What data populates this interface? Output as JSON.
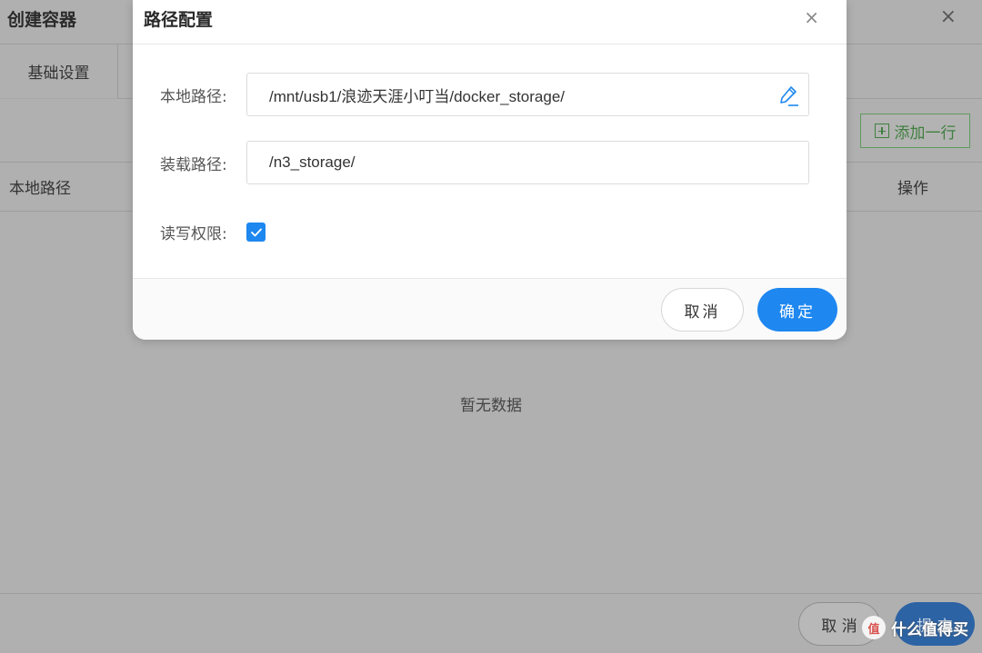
{
  "background": {
    "title": "创建容器",
    "close_glyph": "×",
    "tab_basic": "基础设置",
    "add_row_label": "添加一行",
    "col_local_path": "本地路径",
    "col_operation": "操作",
    "empty_text": "暂无数据",
    "cancel_label": "取 消",
    "submit_label": "提 交"
  },
  "watermark": {
    "badge": "值",
    "text": "什么值得买"
  },
  "modal": {
    "title": "路径配置",
    "close_glyph": "×",
    "local_path_label": "本地路径:",
    "local_path_value": "/mnt/usb1/浪迹天涯小叮当/docker_storage/",
    "mount_path_label": "装载路径:",
    "mount_path_value": "/n3_storage/",
    "rw_label": "读写权限:",
    "rw_checked": true,
    "cancel_label": "取消",
    "ok_label": "确定"
  },
  "colors": {
    "primary": "#1e87f0",
    "overlay": "#b3b3b3",
    "add_row_green": "#3f7f3f"
  },
  "icons": [
    "close-icon",
    "edit-icon",
    "checkmark-icon",
    "plus-square-icon"
  ]
}
